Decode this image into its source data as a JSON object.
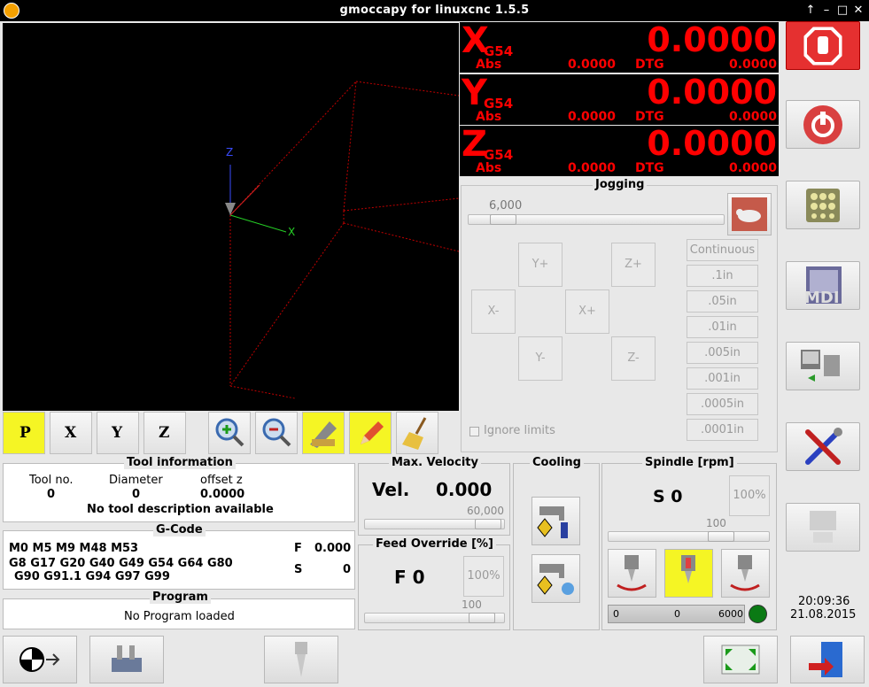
{
  "window": {
    "title": "gmoccapy for linuxcnc   1.5.5",
    "controls": [
      "↑",
      "–",
      "□",
      "✕"
    ]
  },
  "dro": [
    {
      "axis": "X",
      "system": "G54",
      "value": "0.0000",
      "abs_label": "Abs",
      "abs": "0.0000",
      "dtg_label": "DTG",
      "dtg": "0.0000"
    },
    {
      "axis": "Y",
      "system": "G54",
      "value": "0.0000",
      "abs_label": "Abs",
      "abs": "0.0000",
      "dtg_label": "DTG",
      "dtg": "0.0000"
    },
    {
      "axis": "Z",
      "system": "G54",
      "value": "0.0000",
      "abs_label": "Abs",
      "abs": "0.0000",
      "dtg_label": "DTG",
      "dtg": "0.0000"
    }
  ],
  "jogging": {
    "title": "Jogging",
    "speed": "6,000",
    "speed_fraction": 0.1,
    "buttons": {
      "yplus": "Y+",
      "zplus": "Z+",
      "xminus": "X-",
      "xplus": "X+",
      "yminus": "Y-",
      "zminus": "Z-"
    },
    "increments": [
      "Continuous",
      ".1in",
      ".05in",
      ".01in",
      ".005in",
      ".001in",
      ".0005in",
      ".0001in"
    ],
    "ignore_limits": "Ignore limits"
  },
  "view_buttons": {
    "p": "P",
    "x": "X",
    "y": "Y",
    "z": "Z"
  },
  "tool_info": {
    "title": "Tool information",
    "tool_no_label": "Tool no.",
    "tool_no": "0",
    "diameter_label": "Diameter",
    "diameter": "0",
    "offset_label": "offset z",
    "offset": "0.0000",
    "description": "No tool description available"
  },
  "gcode": {
    "title": "G-Code",
    "line1": "M0 M5 M9 M48 M53",
    "line2": "G8 G17 G20 G40 G49 G54 G64 G80",
    "line3": "G90 G91.1 G94 G97 G99",
    "f_label": "F",
    "f_value": "0.000",
    "s_label": "S",
    "s_value": "0"
  },
  "program": {
    "title": "Program",
    "status": "No Program loaded"
  },
  "velocity": {
    "title": "Max. Velocity",
    "label": "Vel.",
    "value": "0.000",
    "max": "60,000",
    "fraction": 0.98
  },
  "feed_override": {
    "title": "Feed Override [%]",
    "value": "F  0",
    "reset": "100%",
    "scale": "100",
    "fraction": 0.92
  },
  "cooling": {
    "title": "Cooling"
  },
  "spindle": {
    "title": "Spindle [rpm]",
    "value": "S 0",
    "reset": "100%",
    "scale": "100",
    "fraction": 0.74,
    "bar_min": "0",
    "bar_current": "0",
    "bar_max": "6000",
    "indicator_color": "#0a7a14"
  },
  "clock": {
    "time": "20:09:36",
    "date": "21.08.2015"
  },
  "side_buttons": [
    "emergency-stop",
    "machine-power",
    "manual-mode",
    "mdi-mode",
    "auto-mode",
    "settings",
    "user-tabs"
  ],
  "side_labels": {
    "mdi": "MDI"
  }
}
